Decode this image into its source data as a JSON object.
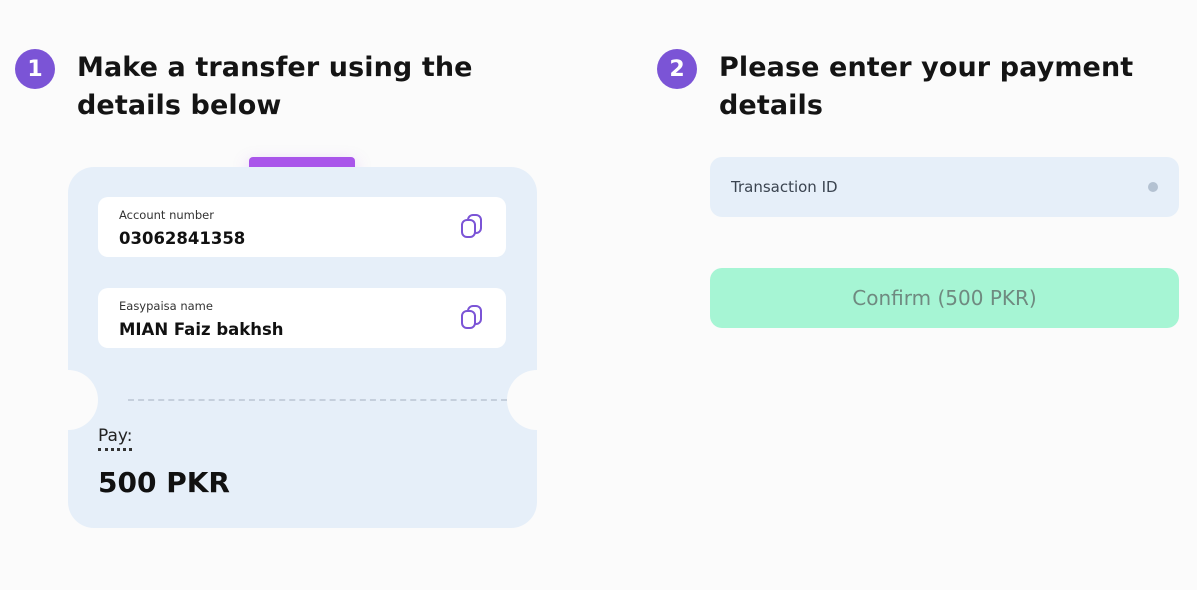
{
  "step1": {
    "number": "1",
    "title": "Make a transfer using the details below",
    "account": {
      "label": "Account number",
      "value": "03062841358"
    },
    "name": {
      "label": "Easypaisa name",
      "value": "MIAN Faiz bakhsh"
    },
    "pay": {
      "label": "Pay:",
      "amount": "500 PKR"
    }
  },
  "step2": {
    "number": "2",
    "title": "Please enter your payment details",
    "transaction_id": {
      "placeholder": "Transaction ID",
      "value": ""
    },
    "confirm_label": "Confirm (500 PKR)"
  },
  "icons": {
    "copy": "copy-icon"
  },
  "colors": {
    "accent": "#7b54d6",
    "tab": "#a955ea",
    "card_bg": "#e6eff9",
    "confirm_bg": "#a6f5d4"
  }
}
